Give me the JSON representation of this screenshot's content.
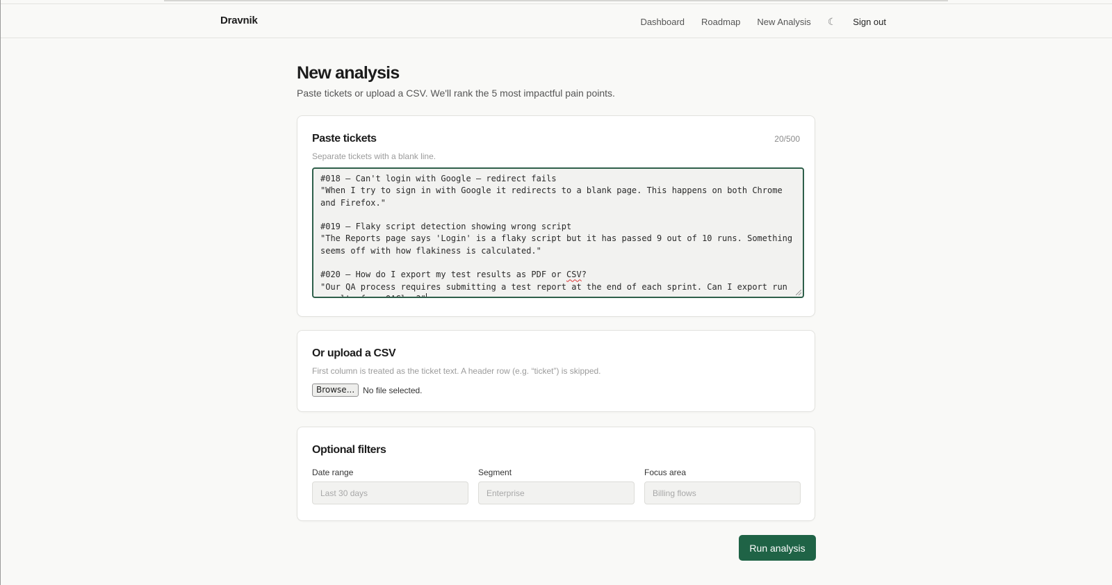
{
  "header": {
    "brand": "Dravnik",
    "nav": {
      "dashboard": "Dashboard",
      "roadmap": "Roadmap",
      "new_analysis": "New Analysis",
      "theme_icon": "moon-icon",
      "theme_glyph": "☾",
      "sign_out": "Sign out"
    }
  },
  "page": {
    "title": "New analysis",
    "subtitle": "Paste tickets or upload a CSV. We'll rank the 5 most impactful pain points."
  },
  "paste": {
    "title": "Paste tickets",
    "help": "Separate tickets with a blank line.",
    "counter": "20/500",
    "lines": [
      "#018 — Can't login with Google — redirect fails",
      "\"When I try to sign in with Google it redirects to a blank page. This happens on both Chrome and Firefox.\"",
      "",
      "#019 — Flaky script detection showing wrong script",
      "\"The Reports page says 'Login' is a flaky script but it has passed 9 out of 10 runs. Something seems off with how flakiness is calculated.\"",
      "",
      "#020 — How do I export my test results as PDF or CSV?",
      "\"Our QA process requires submitting a test report at the end of each sprint. Can I export run results from QAClan?\""
    ]
  },
  "upload": {
    "title": "Or upload a CSV",
    "help": "First column is treated as the ticket text. A header row (e.g. “ticket”) is skipped.",
    "browse_label": "Browse...",
    "file_status": "No file selected."
  },
  "filters": {
    "title": "Optional filters",
    "date_range": {
      "label": "Date range",
      "placeholder": "Last 30 days"
    },
    "segment": {
      "label": "Segment",
      "placeholder": "Enterprise"
    },
    "focus_area": {
      "label": "Focus area",
      "placeholder": "Billing flows"
    }
  },
  "actions": {
    "run": "Run analysis"
  },
  "colors": {
    "accent": "#1f6346",
    "focus_border": "#2e5f4a",
    "background": "#f9f9f7"
  }
}
